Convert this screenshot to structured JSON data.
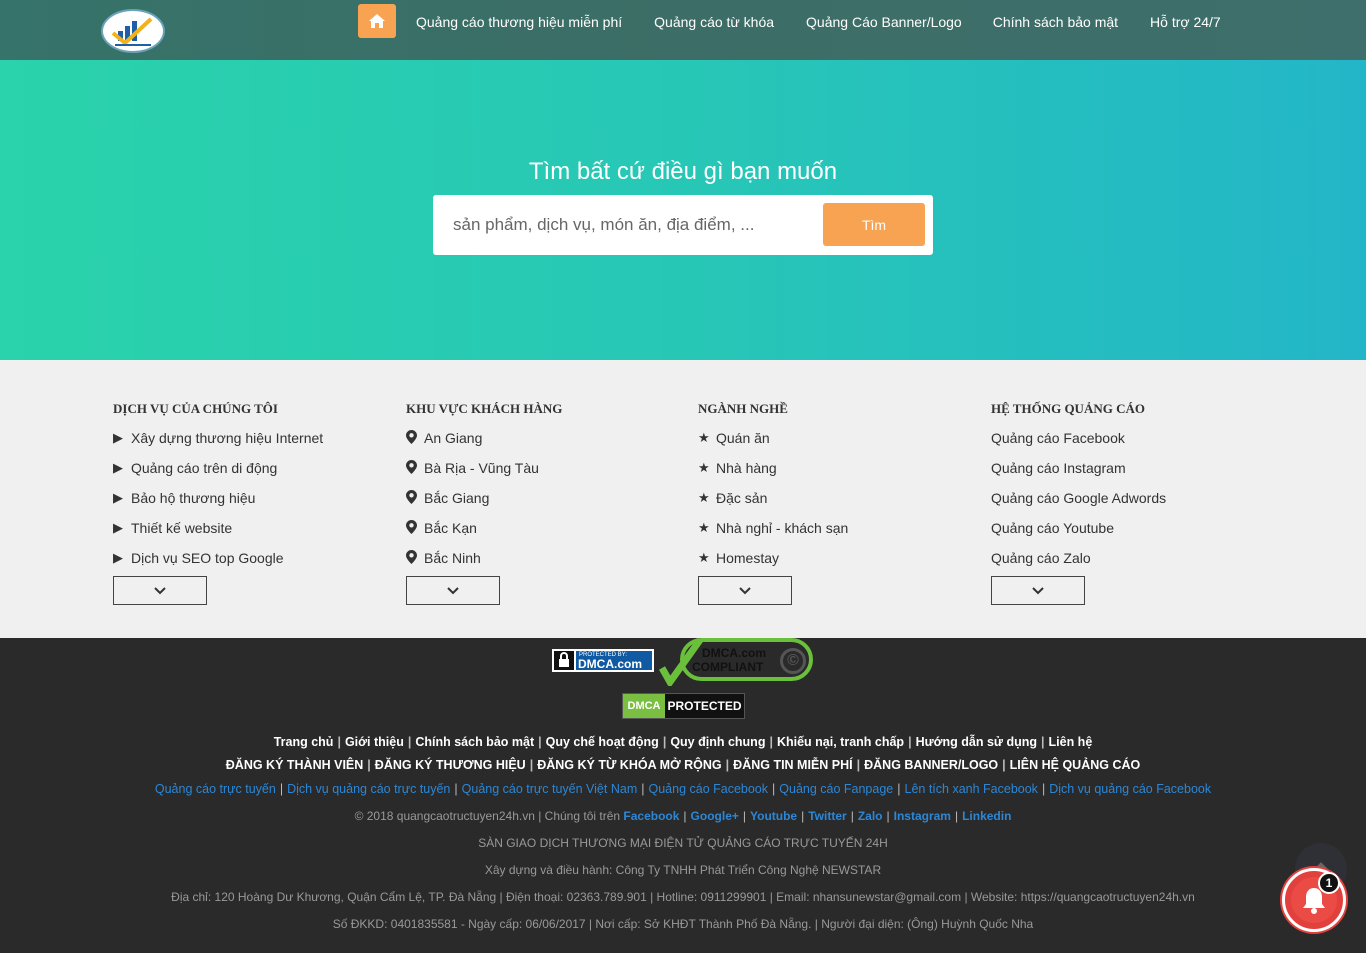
{
  "nav": {
    "links": [
      "Quảng cáo thương hiệu miễn phí",
      "Quảng cáo từ khóa",
      "Quảng Cáo Banner/Logo",
      "Chính sách bảo mật",
      "Hỗ trợ 24/7"
    ]
  },
  "hero": {
    "title": "Tìm bất cứ điều gì bạn muốn",
    "placeholder": "sản phẩm, dịch vụ, món ăn, địa điểm, ...",
    "button": "Tìm"
  },
  "directory": {
    "services": {
      "heading": "DỊCH VỤ CỦA CHÚNG TÔI",
      "items": [
        "Xây dựng thương hiệu Internet",
        "Quảng cáo trên di động",
        "Bảo hộ thương hiệu",
        "Thiết kế website",
        "Dịch vụ SEO top Google"
      ]
    },
    "regions": {
      "heading": "KHU VỰC KHÁCH HÀNG",
      "items": [
        "An Giang",
        "Bà Rịa - Vũng Tàu",
        "Bắc Giang",
        "Bắc Kạn",
        "Bắc Ninh"
      ]
    },
    "industries": {
      "heading": "NGÀNH NGHỀ",
      "items": [
        "Quán ăn",
        "Nhà hàng",
        "Đặc sản",
        "Nhà nghỉ - khách sạn",
        "Homestay"
      ]
    },
    "ads": {
      "heading": "HỆ THỐNG QUẢNG CÁO",
      "items": [
        "Quảng cáo Facebook",
        "Quảng cáo Instagram",
        "Quảng cáo Google Adwords",
        "Quảng cáo Youtube",
        "Quảng cáo Zalo"
      ]
    }
  },
  "dmca": {
    "small_top": "PROTECTED BY:",
    "small_main": "DMCA.com",
    "compliant_1": "DMCA.com",
    "compliant_2": "COMPLIANT",
    "copyright": "©",
    "protected_a": "DMCA",
    "protected_b": "PROTECTED"
  },
  "footer": {
    "line1": [
      "Trang chủ",
      "Giới thiệu",
      "Chính sách bảo mật",
      "Quy chế hoạt động",
      "Quy định chung",
      "Khiếu nại, tranh chấp",
      "Hướng dẫn sử dụng",
      "Liên hệ"
    ],
    "line2": [
      "ĐĂNG KÝ THÀNH VIÊN",
      "ĐĂNG KÝ THƯƠNG HIỆU",
      "ĐĂNG KÝ TỪ KHÓA MỞ RỘNG",
      "ĐĂNG TIN MIỄN PHÍ",
      "ĐĂNG BANNER/LOGO",
      "LIÊN HỆ QUẢNG CÁO"
    ],
    "line3": [
      "Quảng cáo trực tuyến",
      "Dịch vụ quảng cáo trực tuyến",
      "Quảng cáo trực tuyến Việt Nam",
      "Quảng cáo Facebook",
      "Quảng cáo Fanpage",
      "Lên tích xanh Facebook",
      "Dịch vụ quảng cáo Facebook"
    ],
    "line4_prefix": "© 2018 quangcaotructuyen24h.vn | Chúng tôi trên",
    "line4_social": [
      "Facebook",
      "Google+",
      "Youtube",
      "Twitter",
      "Zalo",
      "Instagram",
      "Linkedin"
    ],
    "line5": "SÀN GIAO DỊCH THƯƠNG MẠI ĐIỆN TỬ QUẢNG CÁO TRỰC TUYẾN 24H",
    "line6": "Xây dựng và điều hành: Công Ty TNHH Phát Triển Công Nghệ NEWSTAR",
    "line7": "Địa chỉ: 120 Hoàng Dư Khương, Quận Cẩm Lệ, TP. Đà Nẵng | Điện thoại: 02363.789.901 | Hotline: 0911299901 | Email: nhansunewstar@gmail.com | Website: https://quangcaotructuyen24h.vn",
    "line8": "Số ĐKKD: 0401835581 - Ngày cấp: 06/06/2017 | Nơi cấp: Sở KHĐT Thành Phố Đà Nẵng. | Người đại diện: (Ông) Huỳnh Quốc Nha"
  },
  "notification": {
    "count": "1"
  }
}
